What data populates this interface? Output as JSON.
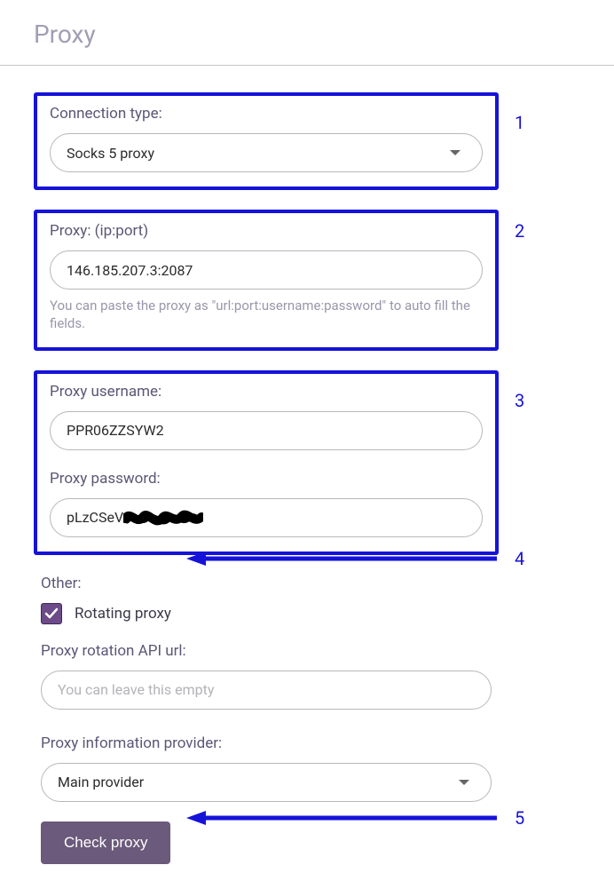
{
  "header": {
    "title": "Proxy"
  },
  "connection": {
    "label": "Connection type:",
    "value": "Socks 5 proxy"
  },
  "proxy": {
    "label": "Proxy: (ip:port)",
    "value": "146.185.207.3:2087",
    "help": "You can paste the proxy as \"url:port:username:password\" to auto fill the fields."
  },
  "credentials": {
    "username_label": "Proxy username:",
    "username_value": "PPR06ZZSYW2",
    "password_label": "Proxy password:",
    "password_visible": "pLzCSeV"
  },
  "other": {
    "label": "Other:",
    "rotating_label": "Rotating proxy",
    "rotating_checked": true
  },
  "rotation_url": {
    "label": "Proxy rotation API url:",
    "placeholder": "You can leave this empty",
    "value": ""
  },
  "provider": {
    "label": "Proxy information provider:",
    "value": "Main provider"
  },
  "actions": {
    "check_label": "Check proxy"
  },
  "annotations": {
    "n1": "1",
    "n2": "2",
    "n3": "3",
    "n4": "4",
    "n5": "5"
  }
}
